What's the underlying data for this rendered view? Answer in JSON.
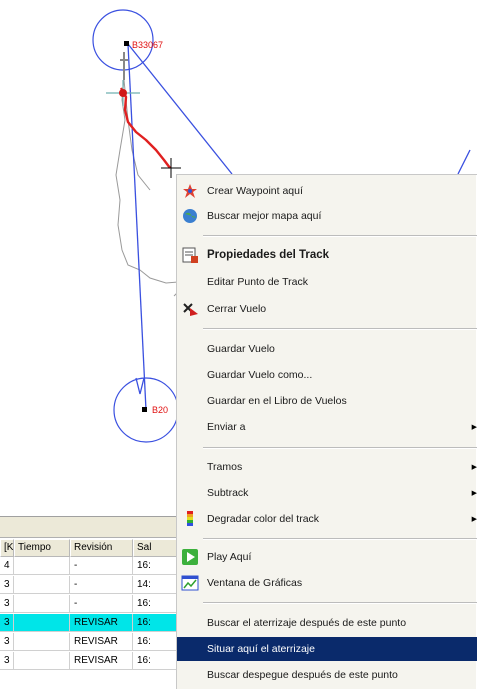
{
  "map": {
    "waypoint_top": "B33067",
    "waypoint_bottom": "B20"
  },
  "table": {
    "headers": [
      "[Km",
      "Tiempo",
      "Revisión",
      "Sal"
    ],
    "rows": [
      [
        "4",
        "-",
        "16:"
      ],
      [
        "3",
        "-",
        "14:"
      ],
      [
        "3",
        "-",
        "16:"
      ],
      [
        "3",
        "REVISAR",
        "16:"
      ],
      [
        "3",
        "REVISAR",
        "16:"
      ],
      [
        "3",
        "REVISAR",
        "16:"
      ]
    ],
    "selected_row": 3
  },
  "menu": {
    "items": [
      {
        "label": "Crear Waypoint aquí",
        "icon": "waypoint-icon"
      },
      {
        "label": "Buscar mejor mapa aquí",
        "icon": "globe-icon"
      },
      {
        "label": "Propiedades del Track",
        "icon": "properties-icon"
      },
      {
        "label": "Editar Punto de Track"
      },
      {
        "label": "Cerrar Vuelo",
        "icon": "close-flight-icon"
      },
      {
        "label": "Guardar Vuelo"
      },
      {
        "label": "Guardar Vuelo como..."
      },
      {
        "label": "Guardar en el Libro de Vuelos"
      },
      {
        "label": "Enviar a"
      },
      {
        "label": "Tramos"
      },
      {
        "label": "Subtrack"
      },
      {
        "label": "Degradar color del track",
        "icon": "gradient-icon"
      },
      {
        "label": "Play Aquí",
        "icon": "play-icon"
      },
      {
        "label": "Ventana de Gráficas",
        "icon": "chart-window-icon"
      },
      {
        "label": "Buscar el aterrizaje después de este punto"
      },
      {
        "label": "Situar aquí el aterrizaje"
      },
      {
        "label": "Buscar despegue después de este punto"
      }
    ],
    "highlighted": "Situar aquí el aterrizaje"
  },
  "colors": {
    "menu_bg": "#f5f4ee",
    "menu_highlight": "#0a2a6b",
    "route_line": "#3a50e0",
    "track_line": "#e02020",
    "selected_row": "#00e5e8"
  }
}
